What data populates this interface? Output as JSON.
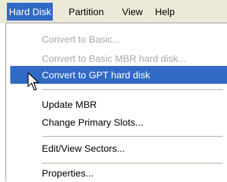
{
  "menubar": {
    "items": [
      {
        "label": "Hard Disk"
      },
      {
        "label": "Partition"
      },
      {
        "label": "View"
      },
      {
        "label": "Help"
      }
    ]
  },
  "hard_disk_menu": {
    "items": [
      {
        "label": "Convert to Basic...",
        "state": "disabled"
      },
      {
        "label": "Convert to Basic MBR hard disk...",
        "state": "disabled"
      },
      {
        "label": "Convert to GPT hard disk",
        "state": "highlighted"
      },
      {
        "label": "Update MBR",
        "state": "enabled"
      },
      {
        "label": "Change Primary Slots...",
        "state": "enabled"
      },
      {
        "label": "Edit/View Sectors...",
        "state": "enabled"
      },
      {
        "label": "Properties...",
        "state": "enabled"
      }
    ]
  },
  "icons": {
    "cursor": "arrow-pointer-icon"
  },
  "colors": {
    "highlight": "#316ac5",
    "menubar_bg": "#ece9d8",
    "disabled_text": "#a8a8a8"
  }
}
